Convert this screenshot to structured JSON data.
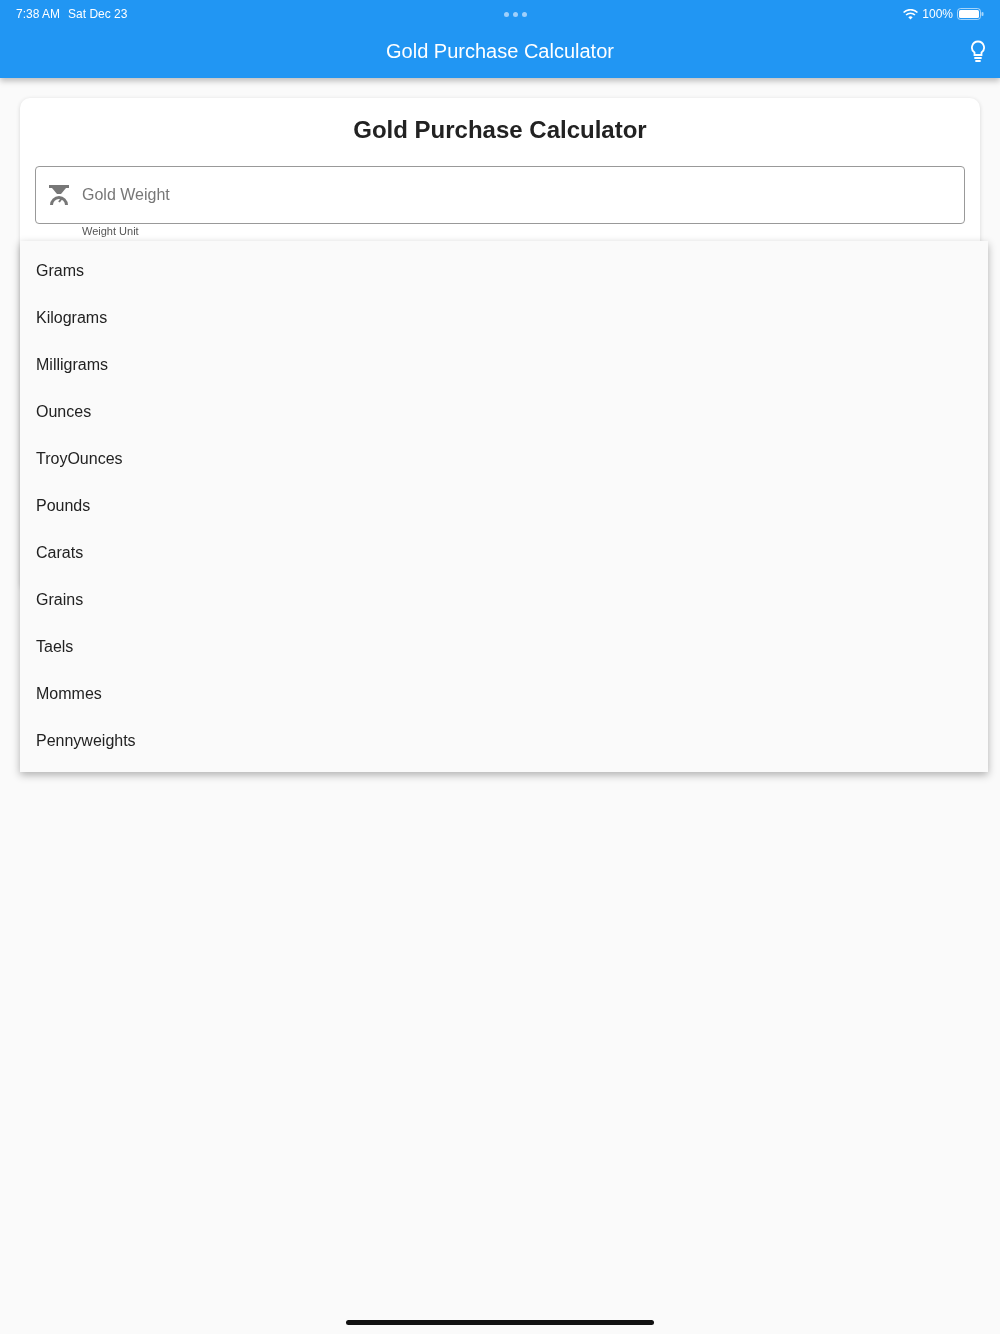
{
  "status_bar": {
    "time": "7:38 AM",
    "date": "Sat Dec 23",
    "battery": "100%"
  },
  "app_bar": {
    "title": "Gold Purchase Calculator"
  },
  "card": {
    "title": "Gold Purchase Calculator",
    "weight_field": {
      "placeholder": "Gold Weight"
    },
    "unit_label": "Weight Unit"
  },
  "unit_menu": {
    "items": [
      {
        "label": "Grams"
      },
      {
        "label": "Kilograms"
      },
      {
        "label": "Milligrams"
      },
      {
        "label": "Ounces"
      },
      {
        "label": "TroyOunces"
      },
      {
        "label": "Pounds"
      },
      {
        "label": "Carats"
      },
      {
        "label": "Grains"
      },
      {
        "label": "Taels"
      },
      {
        "label": "Mommes"
      },
      {
        "label": "Pennyweights"
      }
    ]
  }
}
